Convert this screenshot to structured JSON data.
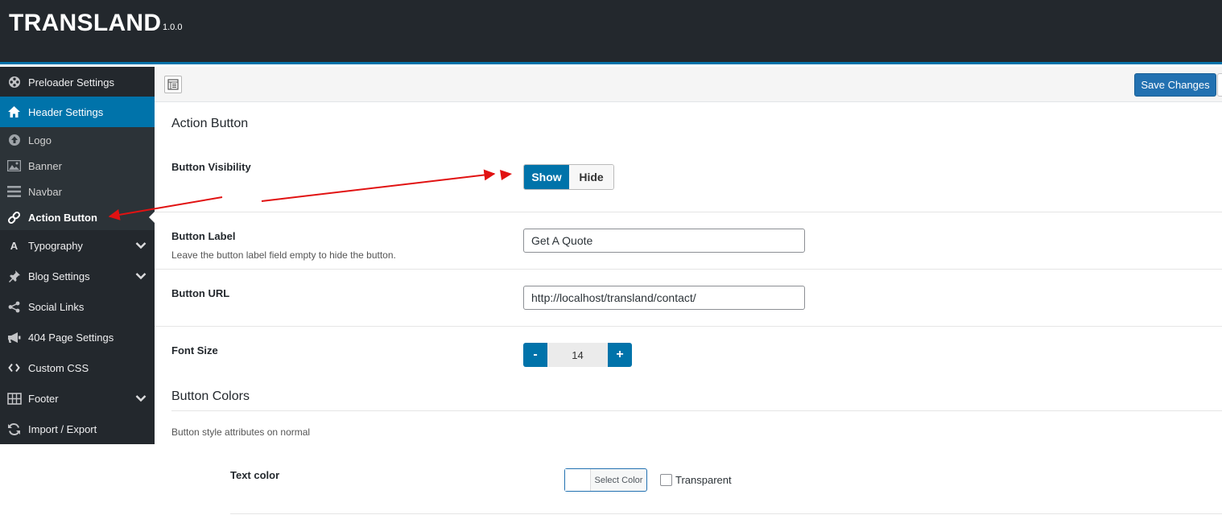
{
  "app": {
    "title": "TRANSLAND",
    "version": "1.0.0"
  },
  "sidebar": {
    "items": [
      {
        "label": "Preloader Settings",
        "icon": "film-reel-icon"
      },
      {
        "label": "Header Settings",
        "icon": "home-icon"
      },
      {
        "label": "Logo",
        "icon": "upload-circle-icon"
      },
      {
        "label": "Banner",
        "icon": "image-icon"
      },
      {
        "label": "Navbar",
        "icon": "menu-icon"
      },
      {
        "label": "Action Button",
        "icon": "link-icon"
      },
      {
        "label": "Typography",
        "icon": "typography-icon"
      },
      {
        "label": "Blog Settings",
        "icon": "pin-icon"
      },
      {
        "label": "Social Links",
        "icon": "share-icon"
      },
      {
        "label": "404 Page Settings",
        "icon": "megaphone-icon"
      },
      {
        "label": "Custom CSS",
        "icon": "code-icon"
      },
      {
        "label": "Footer",
        "icon": "table-icon"
      },
      {
        "label": "Import / Export",
        "icon": "refresh-icon"
      }
    ],
    "active_item": "Header Settings",
    "current_item": "Action Button"
  },
  "toolbar": {
    "save_label": "Save Changes"
  },
  "main": {
    "section_title": "Action Button",
    "visibility": {
      "label": "Button Visibility",
      "options": [
        "Show",
        "Hide"
      ],
      "selected": "Show"
    },
    "button_label": {
      "label": "Button Label",
      "description": "Leave the button label field empty to hide the button.",
      "value": "Get A Quote"
    },
    "button_url": {
      "label": "Button URL",
      "value": "http://localhost/transland/contact/"
    },
    "font_size": {
      "label": "Font Size",
      "value": "14",
      "minus": "-",
      "plus": "+"
    },
    "colors_title": "Button Colors",
    "colors_description": "Button style attributes on normal",
    "text_color": {
      "label": "Text color",
      "select_label": "Select Color",
      "transparent_label": "Transparent"
    }
  },
  "colors": {
    "sidebar_bg": "#23282d",
    "accent": "#0073aa",
    "annotation": "#e11212"
  }
}
